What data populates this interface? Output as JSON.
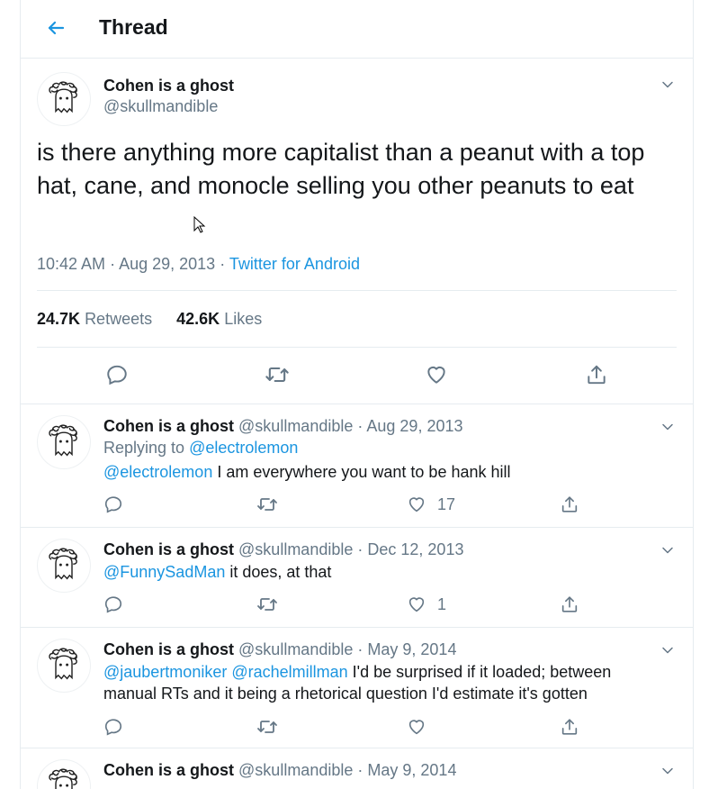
{
  "header": {
    "title": "Thread"
  },
  "main": {
    "name": "Cohen is a ghost",
    "handle": "@skullmandible",
    "text": "is there anything more capitalist than a peanut with a top hat, cane, and monocle selling you other peanuts to eat",
    "time": "10:42 AM",
    "date": "Aug 29, 2013",
    "source": "Twitter for Android",
    "retweets_count": "24.7K",
    "retweets_label": "Retweets",
    "likes_count": "42.6K",
    "likes_label": "Likes"
  },
  "replies": [
    {
      "name": "Cohen is a ghost",
      "handle": "@skullmandible",
      "date": "Aug 29, 2013",
      "replying_label": "Replying to",
      "replying_to": "@electrolemon",
      "mention": "@electrolemon",
      "text": " I am everywhere you want to be hank hill",
      "likes": "17"
    },
    {
      "name": "Cohen is a ghost",
      "handle": "@skullmandible",
      "date": "Dec 12, 2013",
      "mention": "@FunnySadMan",
      "text": " it does, at that",
      "likes": "1"
    },
    {
      "name": "Cohen is a ghost",
      "handle": "@skullmandible",
      "date": "May 9, 2014",
      "mention": "@jaubertmoniker",
      "mention2": "@rachelmillman",
      "text": " I'd be surprised if it loaded; between",
      "text_line2": "manual RTs and it being a rhetorical question I'd estimate it's gotten",
      "likes": ""
    },
    {
      "name": "Cohen is a ghost",
      "handle": "@skullmandible",
      "date": "May 9, 2014"
    }
  ],
  "separator": "·",
  "icons": {
    "back": "arrow-left-icon",
    "caret": "chevron-down-icon",
    "reply": "comment-icon",
    "retweet": "retweet-icon",
    "like": "heart-icon",
    "share": "share-icon"
  },
  "colors": {
    "accent": "#1b95e0",
    "muted": "#657786",
    "text": "#14171a",
    "border": "#e6ecf0"
  }
}
